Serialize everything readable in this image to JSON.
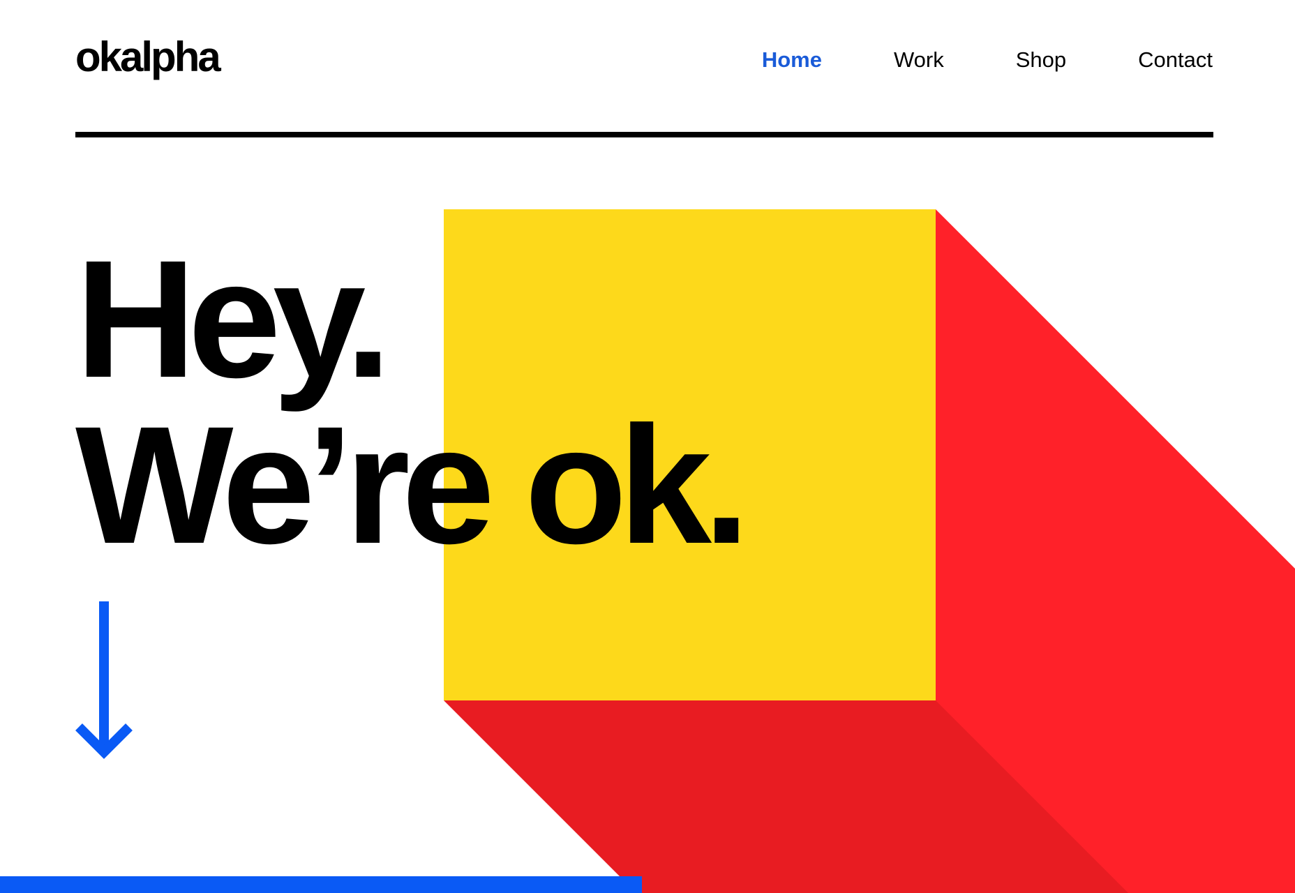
{
  "header": {
    "logo": "okalpha",
    "nav": [
      {
        "label": "Home",
        "active": true
      },
      {
        "label": "Work",
        "active": false
      },
      {
        "label": "Shop",
        "active": false
      },
      {
        "label": "Contact",
        "active": false
      }
    ]
  },
  "hero": {
    "line1": "Hey.",
    "line2": "We’re ok."
  },
  "scroll": {
    "icon": "arrow-down-icon"
  },
  "colors": {
    "accent_blue": "#1a5bd8",
    "bar_blue": "#0a5af5",
    "yellow": "#fdd91b",
    "red": "#ff2129",
    "red_dark": "#e81c22",
    "text": "#000000",
    "background": "#ffffff"
  }
}
